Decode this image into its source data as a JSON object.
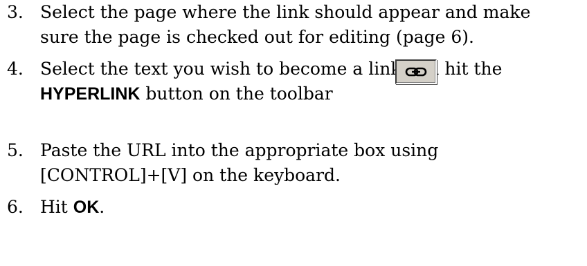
{
  "steps": [
    {
      "number": "3.",
      "lines": [
        "Select the page where the link should appear and make",
        "sure the page is checked out for editing (page 6)."
      ]
    },
    {
      "number": "4.",
      "line1": "Select the text you wish to become a link and hit the",
      "bold_word": "HYPERLINK",
      "line2_rest": " button on the toolbar",
      "button_icon": "chain-link-icon"
    },
    {
      "number": "5.",
      "lines": [
        "Paste the URL into the appropriate box using",
        "[CONTROL]+[V]  on the keyboard."
      ]
    },
    {
      "number": "6.",
      "prefix": "Hit ",
      "bold_word": "OK",
      "suffix": "."
    }
  ]
}
